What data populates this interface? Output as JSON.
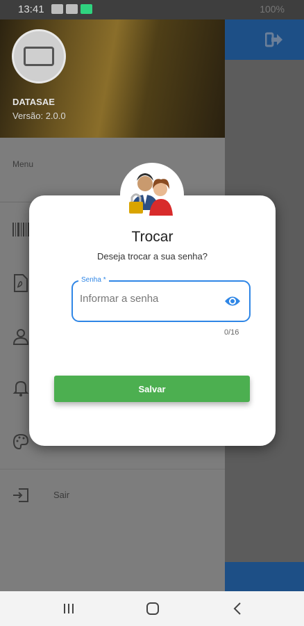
{
  "status_bar": {
    "time": "13:41",
    "right_text": "100%"
  },
  "drawer": {
    "app_name": "DATASAE",
    "version": "Versão: 2.0.0",
    "menu_title": "Menu",
    "items": [
      {
        "icon": "barcode-icon",
        "label": ""
      },
      {
        "icon": "pdf-icon",
        "label": ""
      },
      {
        "icon": "person-icon",
        "label": ""
      },
      {
        "icon": "bell-icon",
        "label": ""
      },
      {
        "icon": "palette-icon",
        "label": ""
      },
      {
        "icon": "exit-icon",
        "label": "Sair"
      }
    ]
  },
  "dialog": {
    "title": "Trocar",
    "subtitle": "Deseja trocar a sua senha?",
    "field_label": "Senha *",
    "field_placeholder": "Informar a senha",
    "field_value": "",
    "counter": "0/16",
    "save_label": "Salvar"
  },
  "colors": {
    "accent": "#2f86e6",
    "save": "#4caf50",
    "header": "#1d4f86"
  }
}
